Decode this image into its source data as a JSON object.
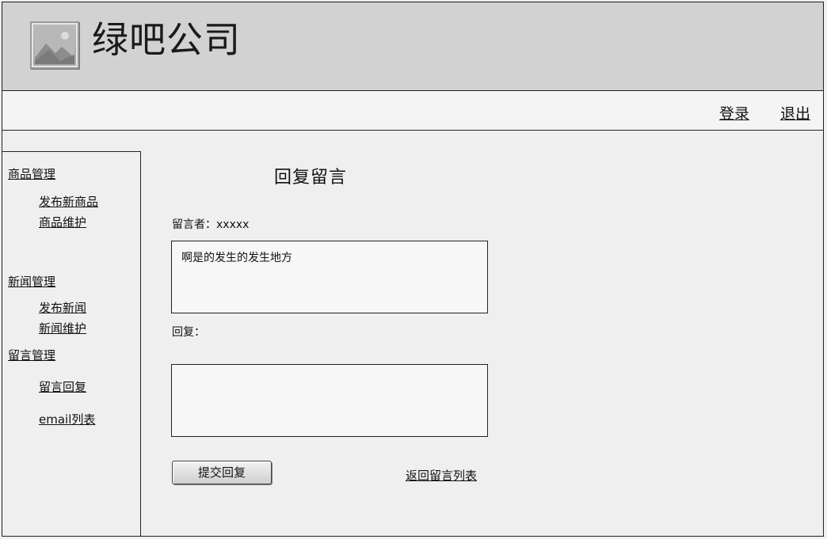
{
  "header": {
    "company_name": "绿吧公司",
    "logo_icon": "image-placeholder-icon"
  },
  "toolbar": {
    "login": "登录",
    "logout": "退出"
  },
  "sidebar": {
    "groups": [
      {
        "label": "商品管理",
        "items": [
          "发布新商品",
          "商品维护"
        ]
      },
      {
        "label": "新闻管理",
        "items": [
          "发布新闻",
          "新闻维护"
        ]
      },
      {
        "label": "留言管理",
        "items": [
          "留言回复",
          "email列表"
        ]
      }
    ]
  },
  "main": {
    "title": "回复留言",
    "author_label": "留言者：",
    "author_name": "xxxxx",
    "message_text": "啊是的发生的发生地方",
    "reply_label": "回复：",
    "reply_value": "",
    "submit_label": "提交回复",
    "return_link": "返回留言列表"
  }
}
